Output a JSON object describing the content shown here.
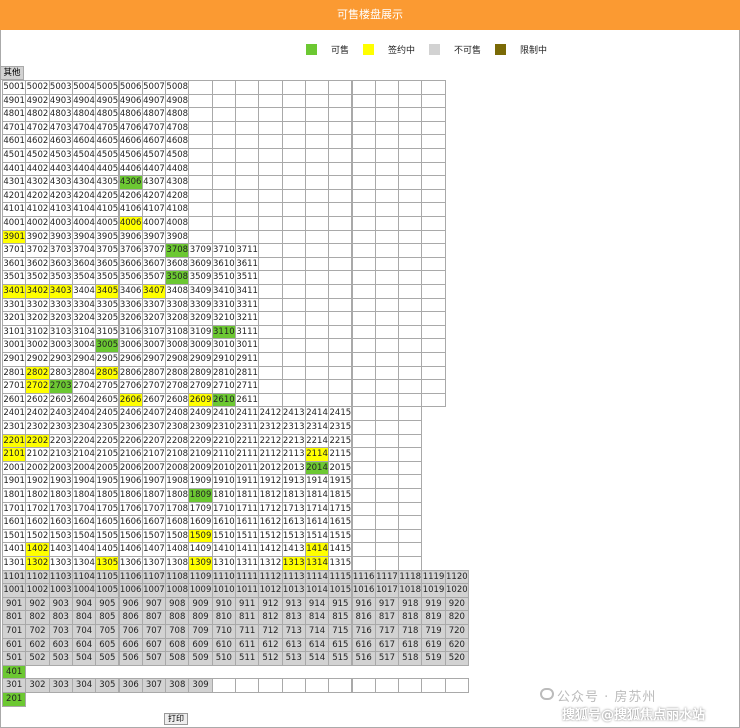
{
  "header": {
    "title": "可售楼盘展示"
  },
  "legend": [
    {
      "label": "可售",
      "color": "#6cc832"
    },
    {
      "label": "签约中",
      "color": "#ffff00"
    },
    {
      "label": "不可售",
      "color": "#d2d2d2"
    },
    {
      "label": "限制中",
      "color": "#7a6a06"
    }
  ],
  "status_colors": {
    "sale": "#6cc832",
    "signing": "#ffff00",
    "unsold": "#d2d2d2",
    "empty": "#ffffff"
  },
  "table": {
    "header_label": "其他",
    "rows": [
      {
        "floor": 50,
        "units": 8,
        "slots": 19
      },
      {
        "floor": 49,
        "units": 8,
        "slots": 19
      },
      {
        "floor": 48,
        "units": 8,
        "slots": 19
      },
      {
        "floor": 47,
        "units": 8,
        "slots": 19
      },
      {
        "floor": 46,
        "units": 8,
        "slots": 19
      },
      {
        "floor": 45,
        "units": 8,
        "slots": 19
      },
      {
        "floor": 44,
        "units": 8,
        "slots": 19
      },
      {
        "floor": 43,
        "units": 8,
        "slots": 19,
        "sale": [
          6
        ]
      },
      {
        "floor": 42,
        "units": 8,
        "slots": 19
      },
      {
        "floor": 41,
        "units": 8,
        "slots": 19
      },
      {
        "floor": 40,
        "units": 8,
        "slots": 19,
        "sign": [
          6
        ]
      },
      {
        "floor": 39,
        "units": 8,
        "slots": 19,
        "sign": [
          1
        ]
      },
      {
        "floor": 37,
        "units": 11,
        "slots": 19,
        "sale": [
          8
        ]
      },
      {
        "floor": 36,
        "units": 11,
        "slots": 19
      },
      {
        "floor": 35,
        "units": 11,
        "slots": 19,
        "sale": [
          8
        ]
      },
      {
        "floor": 34,
        "units": 11,
        "slots": 19,
        "sign": [
          1,
          2,
          3,
          5,
          7
        ]
      },
      {
        "floor": 33,
        "units": 11,
        "slots": 19
      },
      {
        "floor": 32,
        "units": 11,
        "slots": 19
      },
      {
        "floor": 31,
        "units": 11,
        "slots": 19,
        "sale": [
          10
        ]
      },
      {
        "floor": 30,
        "units": 11,
        "slots": 19,
        "sale": [
          5
        ]
      },
      {
        "floor": 29,
        "units": 11,
        "slots": 19
      },
      {
        "floor": 28,
        "units": 11,
        "slots": 19,
        "sign": [
          2,
          5
        ]
      },
      {
        "floor": 27,
        "units": 11,
        "slots": 19,
        "sign": [
          2
        ],
        "sale": [
          3
        ]
      },
      {
        "floor": 26,
        "units": 11,
        "slots": 19,
        "sign": [
          6,
          9
        ],
        "sale": [
          10
        ]
      },
      {
        "floor": 24,
        "units": 15,
        "slots": 18
      },
      {
        "floor": 23,
        "units": 15,
        "slots": 18
      },
      {
        "floor": 22,
        "units": 15,
        "slots": 18,
        "sign": [
          1,
          2
        ]
      },
      {
        "floor": 21,
        "units": 15,
        "slots": 18,
        "sign": [
          1,
          14
        ]
      },
      {
        "floor": 20,
        "units": 15,
        "slots": 18,
        "sale": [
          14
        ]
      },
      {
        "floor": 19,
        "units": 15,
        "slots": 18
      },
      {
        "floor": 18,
        "units": 15,
        "slots": 18,
        "sale": [
          9
        ]
      },
      {
        "floor": 17,
        "units": 15,
        "slots": 18
      },
      {
        "floor": 16,
        "units": 15,
        "slots": 18
      },
      {
        "floor": 15,
        "units": 15,
        "slots": 18,
        "sign": [
          9
        ]
      },
      {
        "floor": 14,
        "units": 15,
        "slots": 18,
        "sign": [
          2,
          14
        ]
      },
      {
        "floor": 13,
        "units": 15,
        "slots": 18,
        "sign": [
          2,
          5,
          9,
          13,
          14
        ]
      },
      {
        "floor": 11,
        "units": 20,
        "slots": 20,
        "grey": true
      },
      {
        "floor": 10,
        "units": 20,
        "slots": 20,
        "grey": true
      },
      {
        "floor": 9,
        "units": 20,
        "slots": 20,
        "grey": true
      },
      {
        "floor": 8,
        "units": 20,
        "slots": 20,
        "grey": true
      },
      {
        "floor": 7,
        "units": 20,
        "slots": 20,
        "grey": true
      },
      {
        "floor": 6,
        "units": 20,
        "slots": 20,
        "grey": true
      },
      {
        "floor": 5,
        "units": 20,
        "slots": 20,
        "grey": true
      },
      {
        "floor": 4,
        "units": 1,
        "slots": 1,
        "sale": [
          1
        ]
      },
      {
        "floor": 3,
        "units": 9,
        "slots": 20,
        "grey": true
      },
      {
        "floor": 2,
        "units": 1,
        "slots": 1,
        "sale": [
          1
        ]
      }
    ]
  },
  "print_button": {
    "label": "打印"
  },
  "watermark": {
    "line1": "公众号 · 房苏州",
    "line2": "搜狐号@搜狐焦点丽水站"
  }
}
